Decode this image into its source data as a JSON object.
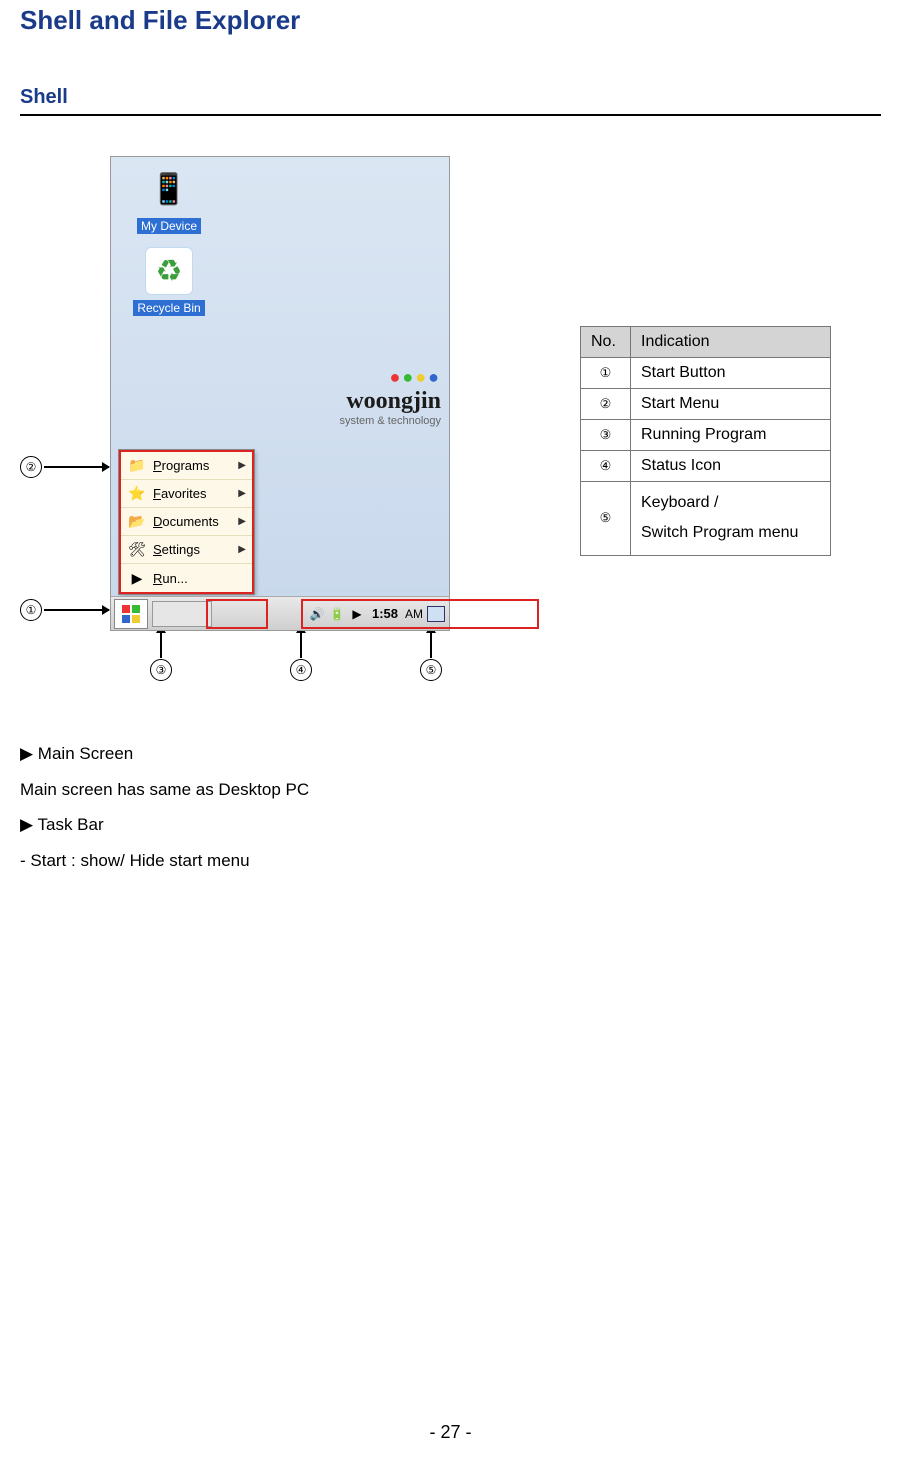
{
  "title": "Shell and File Explorer",
  "subtitle": "Shell",
  "callouts": {
    "c1": "①",
    "c2": "②",
    "c3": "③",
    "c4": "④",
    "c5": "⑤"
  },
  "desktop": {
    "my_device_label": "My Device",
    "recycle_label": "Recycle Bin",
    "logo_name": "woongjin",
    "logo_sub": "system & technology"
  },
  "start_menu": {
    "items": [
      {
        "label": "Programs",
        "arrow": true
      },
      {
        "label": "Favorites",
        "arrow": true
      },
      {
        "label": "Documents",
        "arrow": true
      },
      {
        "label": "Settings",
        "arrow": true
      },
      {
        "label": "Run...",
        "arrow": false
      }
    ]
  },
  "taskbar": {
    "clock": "1:58",
    "ampm": "AM"
  },
  "legend": {
    "head_no": "No.",
    "head_ind": "Indication",
    "rows": [
      {
        "no": "①",
        "ind": "Start Button"
      },
      {
        "no": "②",
        "ind": "Start Menu"
      },
      {
        "no": "③",
        "ind": "Running Program"
      },
      {
        "no": "④",
        "ind": "Status Icon"
      },
      {
        "no": "⑤",
        "ind": "Keyboard /\nSwitch Program menu"
      }
    ]
  },
  "body": {
    "l1": "▶ Main Screen",
    "l2": "Main screen has same as Desktop PC",
    "l3": "▶ Task Bar",
    "l4": "- Start : show/ Hide start menu"
  },
  "page_num": "- 27 -"
}
